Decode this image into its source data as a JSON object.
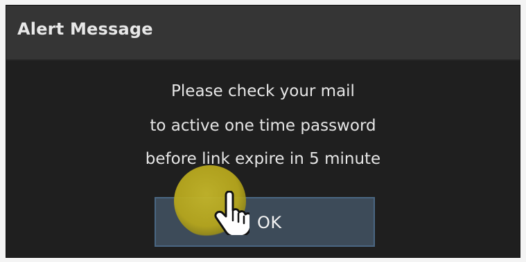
{
  "dialog": {
    "title": "Alert Message",
    "message_lines": [
      "Please check your mail",
      "to active one time password",
      "before link expire in 5 minute"
    ],
    "ok_label": "OK"
  },
  "colors": {
    "titlebar": "#353535",
    "body": "#1f1f1f",
    "text": "#e6e6e6",
    "button_fill": "#3d4b59",
    "button_border": "#4a6783",
    "click_highlight": "#c4b62a"
  },
  "icons": {
    "cursor": "hand-pointer-icon"
  }
}
